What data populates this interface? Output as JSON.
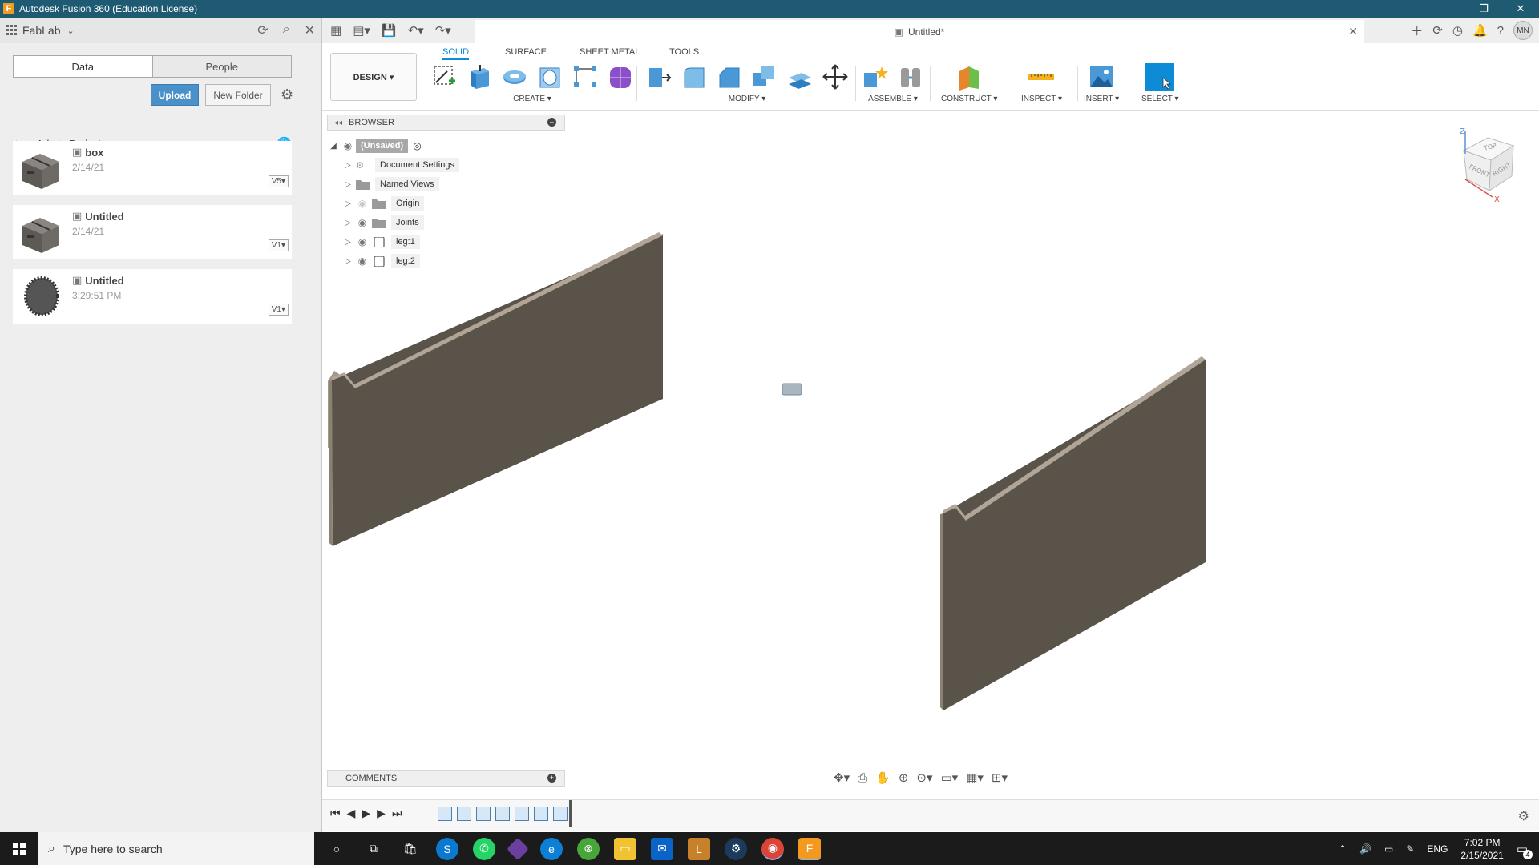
{
  "window": {
    "title": "Autodesk Fusion 360 (Education License)",
    "logo_letter": "F",
    "minimize": "–",
    "restore": "❐",
    "close": "✕"
  },
  "datapanel": {
    "team": "FabLab",
    "tabs": [
      {
        "label": "Data",
        "active": true
      },
      {
        "label": "People",
        "active": false
      }
    ],
    "upload_label": "Upload",
    "new_folder_label": "New Folder",
    "breadcrumb": "Admin Project",
    "files": [
      {
        "name": "box",
        "date": "2/14/21",
        "version": "V5▾"
      },
      {
        "name": "Untitled",
        "date": "2/14/21",
        "version": "V1▾"
      },
      {
        "name": "Untitled",
        "date": "3:29:51 PM",
        "version": "V1▾"
      }
    ]
  },
  "document": {
    "tab_title": "Untitled*"
  },
  "user": {
    "initials": "MN"
  },
  "ribbon": {
    "tabs": [
      "SOLID",
      "SURFACE",
      "SHEET METAL",
      "TOOLS"
    ],
    "active_tab": "SOLID",
    "workspace": "DESIGN ▾",
    "groups": [
      "CREATE ▾",
      "MODIFY ▾",
      "ASSEMBLE ▾",
      "CONSTRUCT ▾",
      "INSPECT ▾",
      "INSERT ▾",
      "SELECT ▾"
    ]
  },
  "browser": {
    "title": "BROWSER",
    "root": "(Unsaved)",
    "items": [
      {
        "label": "Document Settings",
        "icon": "gear-icon"
      },
      {
        "label": "Named Views",
        "icon": "folder-icon"
      },
      {
        "label": "Origin",
        "icon": "folder-icon"
      },
      {
        "label": "Joints",
        "icon": "folder-icon"
      },
      {
        "label": "leg:1",
        "icon": "component-icon"
      },
      {
        "label": "leg:2",
        "icon": "component-icon"
      }
    ]
  },
  "viewcube": {
    "top": "TOP",
    "front": "FRONT",
    "right": "RIGHT",
    "axis_z": "Z",
    "axis_x": "X"
  },
  "comments": {
    "title": "COMMENTS"
  },
  "taskbar": {
    "search_placeholder": "Type here to search",
    "language": "ENG",
    "time": "7:02 PM",
    "date": "2/15/2021",
    "notifications": "4"
  },
  "colors": {
    "titlebar": "#1e5a72",
    "accent": "#0d8bd6",
    "upload": "#4a90c9",
    "part_face": "#5a5349",
    "part_edge": "#a39887"
  }
}
